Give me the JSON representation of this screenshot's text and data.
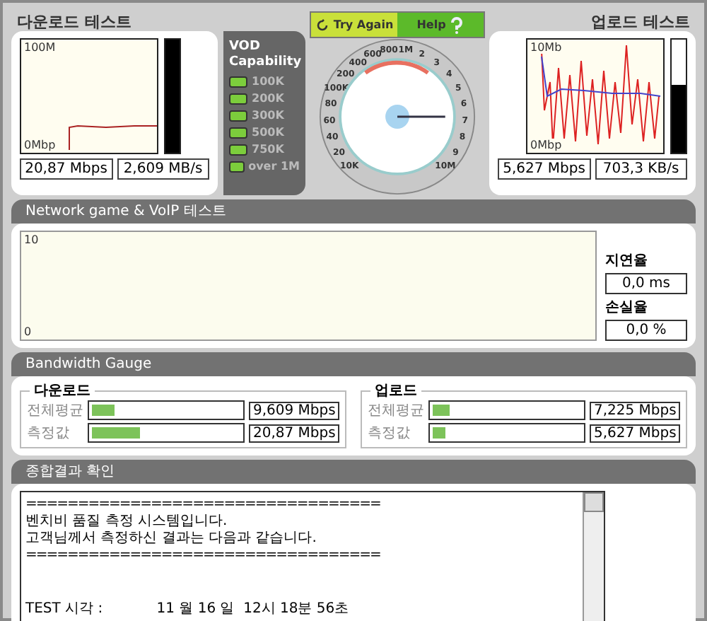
{
  "download_test": {
    "title": "다운로드 테스트",
    "y_max": "100M",
    "y_min": "0Mbp",
    "level": 1,
    "readouts": [
      "20,87 Mbps",
      "2,609 MB/s"
    ]
  },
  "vod": {
    "title": "VOD Capability",
    "items": [
      {
        "label": "100K",
        "on": true
      },
      {
        "label": "200K",
        "on": true
      },
      {
        "label": "300K",
        "on": true
      },
      {
        "label": "500K",
        "on": true
      },
      {
        "label": "750K",
        "on": true
      },
      {
        "label": "over 1M",
        "on": true
      }
    ]
  },
  "buttons": [
    {
      "label": "Try Again",
      "kind": "retry"
    },
    {
      "label": "Help",
      "kind": "help"
    }
  ],
  "gauge": {
    "top_scale": [
      "100K",
      "200",
      "400",
      "600",
      "800",
      "1M"
    ],
    "left_scale": [
      "80",
      "60",
      "40",
      "20",
      "10K"
    ],
    "right_scale": [
      "2",
      "3",
      "4",
      "5",
      "6",
      "7",
      "8",
      "9",
      "10M"
    ]
  },
  "upload_test": {
    "title": "업로드 테스트",
    "y_max": "10Mb",
    "y_min": "0Mbp",
    "level": 0.6,
    "readouts": [
      "5,627 Mbps",
      "703,3 KB/s"
    ]
  },
  "network": {
    "title": "Network game & VoIP 테스트",
    "y_max": "10",
    "y_min": "0",
    "stats": [
      {
        "label": "지연율",
        "value": "0,0 ms"
      },
      {
        "label": "손실율",
        "value": "0,0 %"
      }
    ]
  },
  "bandwidth": {
    "title": "Bandwidth Gauge",
    "groups": [
      {
        "title": "다운로드",
        "rows": [
          {
            "label": "전체평균",
            "level": 0.15,
            "value": "9,609 Mbps"
          },
          {
            "label": "측정값",
            "level": 0.32,
            "value": "20,87 Mbps"
          }
        ]
      },
      {
        "title": "업로드",
        "rows": [
          {
            "label": "전체평균",
            "level": 0.11,
            "value": "7,225 Mbps"
          },
          {
            "label": "측정값",
            "level": 0.09,
            "value": "5,627 Mbps"
          }
        ]
      }
    ]
  },
  "summary": {
    "title": "종합결과 확인",
    "lines": [
      {
        "kind": "rule",
        "text": "=================================="
      },
      {
        "kind": "text",
        "text": "벤치비 품질 측정 시스템입니다."
      },
      {
        "kind": "text",
        "text": "고객님께서 측정하신 결과는 다음과 같습니다."
      },
      {
        "kind": "rule",
        "text": "=================================="
      },
      {
        "kind": "spaced",
        "text": "TEST 시각 :            11 월 16 일  12시 18분 56초"
      }
    ]
  }
}
